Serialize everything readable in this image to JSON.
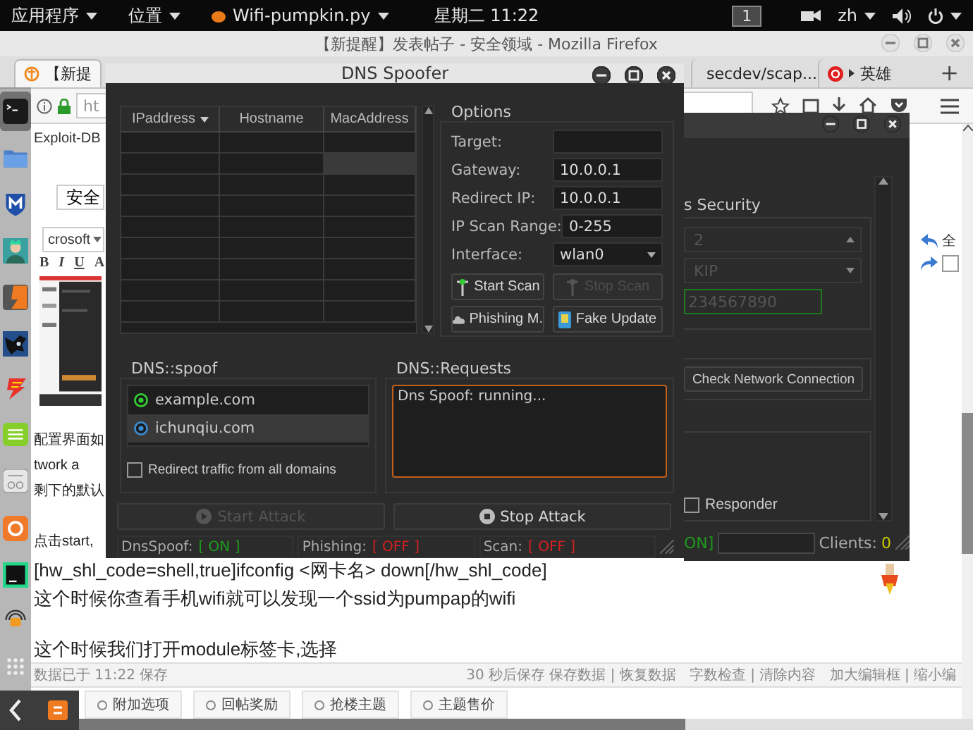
{
  "topbar": {
    "menus": [
      {
        "label": "应用程序",
        "kind": "menu"
      },
      {
        "label": "位置",
        "kind": "menu"
      },
      {
        "label": "Wifi-pumpkin.py",
        "kind": "app"
      }
    ],
    "clock": "星期二 11:22",
    "workspace": "1",
    "language": "zh"
  },
  "firefox": {
    "title": "【新提醒】发表帖子 - 安全领域 - Mozilla Firefox",
    "tabs": [
      {
        "label": "【新提",
        "selected": true,
        "kind": "forum"
      },
      {
        "label": "secdev/scap...",
        "selected": false,
        "kind": "github"
      },
      {
        "label": "英雄",
        "selected": false,
        "kind": "music"
      }
    ],
    "new_tab": "+",
    "url": "ht"
  },
  "page": {
    "bookmark": "Exploit-DB",
    "search_value": "安全",
    "font_select": "crosoft",
    "editor_buttons": [
      "B",
      "I",
      "U",
      "A"
    ],
    "lines": [
      {
        "text": "配置界面如",
        "kind": "fragment"
      },
      {
        "text": "twork a",
        "kind": "fragment"
      },
      {
        "text": "剩下的默认",
        "kind": "fragment"
      },
      {
        "text": "点击start,",
        "kind": "fragment_paragraph"
      },
      {
        "text": "[hw_shl_code=shell,true]ifconfig <网卡名> down[/hw_shl_code]",
        "kind": "line"
      },
      {
        "text": "这个时候你查看手机wifi就可以发现一个ssid为pumpap的wifi",
        "kind": "line"
      },
      {
        "text": "这个时候我们打开module标签卡,选择",
        "kind": "paragraph"
      }
    ],
    "side_label": "全",
    "side_checked": false,
    "save_status": "数据已于 11:22 保存",
    "editor_status": "30 秒后保存 保存数据 | 恢复数据   字数检查 | 清除内容   加大编辑框 | 缩小编",
    "option_tabs": [
      "附加选项",
      "回帖奖励",
      "抢楼主题",
      "主题售价"
    ]
  },
  "main_window": {
    "security_title": "s Security",
    "combos": [
      {
        "value": "2"
      },
      {
        "value": "KIP"
      }
    ],
    "key_field": "234567890",
    "check_button": "Check Network Connection",
    "responder": {
      "label": "Responder",
      "checked": false
    },
    "status_value": "ON]",
    "clients_label": "Clients:",
    "clients": "0"
  },
  "dns_spoofer": {
    "title": "DNS Spoofer",
    "table": {
      "columns": [
        {
          "label": "IPaddress",
          "sorted": true
        },
        {
          "label": "Hostname",
          "sorted": false
        },
        {
          "label": "MacAddress",
          "sorted": false
        }
      ],
      "rows": [
        {
          "selected": false
        },
        {
          "selected": true
        },
        {
          "selected": false
        },
        {
          "selected": false
        },
        {
          "selected": false
        },
        {
          "selected": false
        },
        {
          "selected": false
        },
        {
          "selected": false
        },
        {
          "selected": false
        }
      ]
    },
    "options": {
      "title": "Options",
      "fields": [
        {
          "label": "Target:",
          "kind": "input"
        },
        {
          "label": "Gateway:",
          "kind": "input",
          "value": "10.0.0.1"
        },
        {
          "label": "Redirect IP:",
          "kind": "input",
          "value": "10.0.0.1"
        },
        {
          "label": "IP Scan Range:",
          "kind": "input",
          "value": "0-255"
        },
        {
          "label": "Interface:",
          "kind": "select",
          "value": "wlan0"
        }
      ],
      "buttons": [
        {
          "label": "Start Scan",
          "disabled": false,
          "kind": "antenna"
        },
        {
          "label": "Stop Scan",
          "disabled": true,
          "kind": "antenna"
        },
        {
          "label": "Phishing M.",
          "disabled": false,
          "kind": "cloud"
        },
        {
          "label": "Fake Update",
          "disabled": false,
          "kind": "update"
        }
      ]
    },
    "spoof": {
      "title": "DNS::spoof",
      "domains": [
        {
          "label": "example.com",
          "selected": false
        },
        {
          "label": "ichunqiu.com",
          "selected": true
        }
      ],
      "redirect_all": {
        "label": "Redirect traffic from all domains",
        "checked": false
      }
    },
    "requests": {
      "title": "DNS::Requests",
      "log": "Dns Spoof: running..."
    },
    "attack": [
      {
        "label": "Start Attack",
        "disabled": true,
        "kind": "start"
      },
      {
        "label": "Stop Attack",
        "disabled": false,
        "kind": "stop"
      }
    ],
    "status": [
      {
        "label": "DnsSpoof:",
        "value": "[ ON ]",
        "on": true
      },
      {
        "label": "Phishing:",
        "value": "[ OFF ]",
        "on": false
      },
      {
        "label": "Scan:",
        "value": "[ OFF ]",
        "on": false
      }
    ]
  }
}
